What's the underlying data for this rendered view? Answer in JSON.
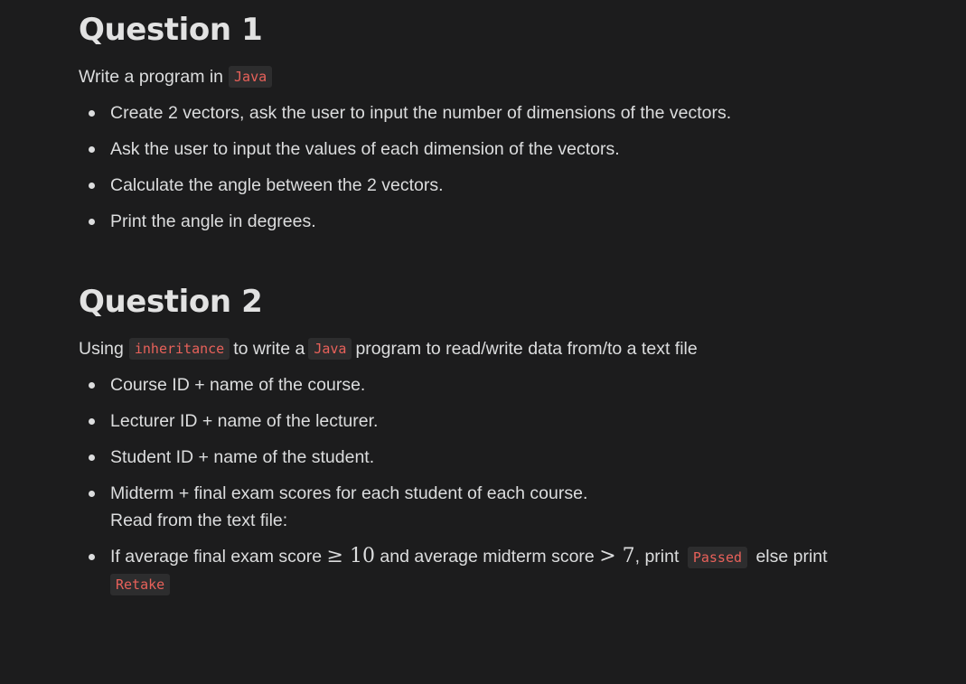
{
  "q1": {
    "title": "Question 1",
    "lead_text": "Write a program in",
    "lead_code": "Java",
    "items": [
      "Create 2 vectors, ask the user to input the number of dimensions of the vectors.",
      "Ask the user to input the values of each dimension of the vectors.",
      "Calculate the angle between the 2 vectors.",
      "Print the angle in degrees."
    ]
  },
  "q2": {
    "title": "Question 2",
    "lead_pre": "Using",
    "lead_code1": "inheritance",
    "lead_mid": "to write a",
    "lead_code2": "Java",
    "lead_post": "program to read/write data from/to a text file",
    "items": [
      "Course ID + name of the course.",
      "Lecturer ID + name of the lecturer.",
      "Student ID + name of the student.",
      "Midterm + final exam scores for each student of each course."
    ],
    "item4_line2": "Read from the text file:",
    "item5": {
      "t1": "If average final exam score",
      "m1": "≥ 10",
      "t2": "and average midterm score",
      "m2": "> 7",
      "t3": ", print",
      "code1": "Passed",
      "t4": "else print",
      "code2": "Retake"
    }
  }
}
